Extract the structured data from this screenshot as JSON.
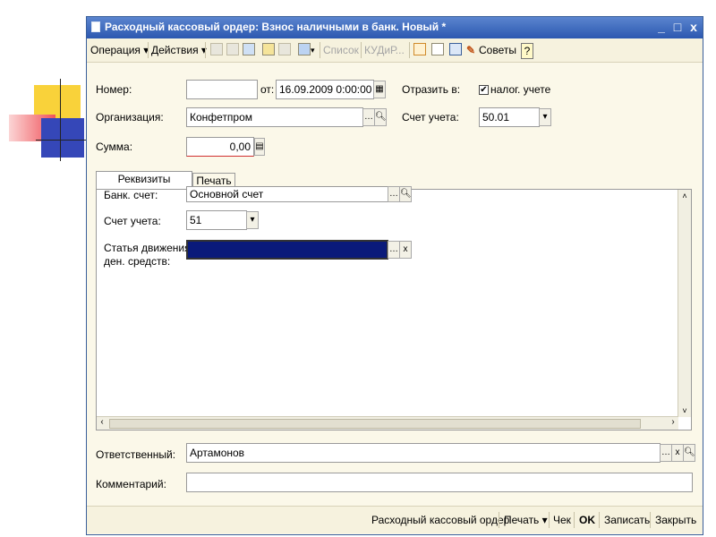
{
  "window": {
    "title": "Расходный кассовый ордер: Взнос наличными в банк. Новый *",
    "min": "_",
    "max": "□",
    "close": "x"
  },
  "toolbar": {
    "operation": "Операция ▾",
    "actions": "Действия ▾",
    "list": "Список",
    "kud": "КУДиР...",
    "tips": "Советы",
    "help": "?"
  },
  "form": {
    "number_label": "Номер:",
    "number_value": "",
    "from_label": "от:",
    "date_value": "16.09.2009 0:00:00",
    "reflect_label": "Отразить в:",
    "tax_label": "налог. учете",
    "tax_checked": "✔",
    "org_label": "Организация:",
    "org_value": "Конфетпром",
    "account_label": "Счет учета:",
    "account_value": "50.01",
    "sum_label": "Сумма:",
    "sum_value": "0,00"
  },
  "tabs": [
    {
      "label": "Реквизиты платежа"
    },
    {
      "label": "Печать"
    }
  ],
  "panel": {
    "bank_label": "Банк. счет:",
    "bank_value": "Основной счет",
    "account_label": "Счет учета:",
    "account_value": "51",
    "flow_label_1": "Статья движения",
    "flow_label_2": "ден. средств:",
    "flow_value": ""
  },
  "footer": {
    "responsible_label": "Ответственный:",
    "responsible_value": "Артамонов",
    "comment_label": "Комментарий:",
    "comment_value": ""
  },
  "statusbar": {
    "print_doc": "Расходный кассовый ордер",
    "print": "Печать ▾",
    "check": "Чек",
    "ok": "OK",
    "save": "Записать",
    "close": "Закрыть"
  },
  "colors": {
    "titlebar": "#2c58b0",
    "selection": "#0a1a7a",
    "form_bg": "#fbf8e9"
  }
}
